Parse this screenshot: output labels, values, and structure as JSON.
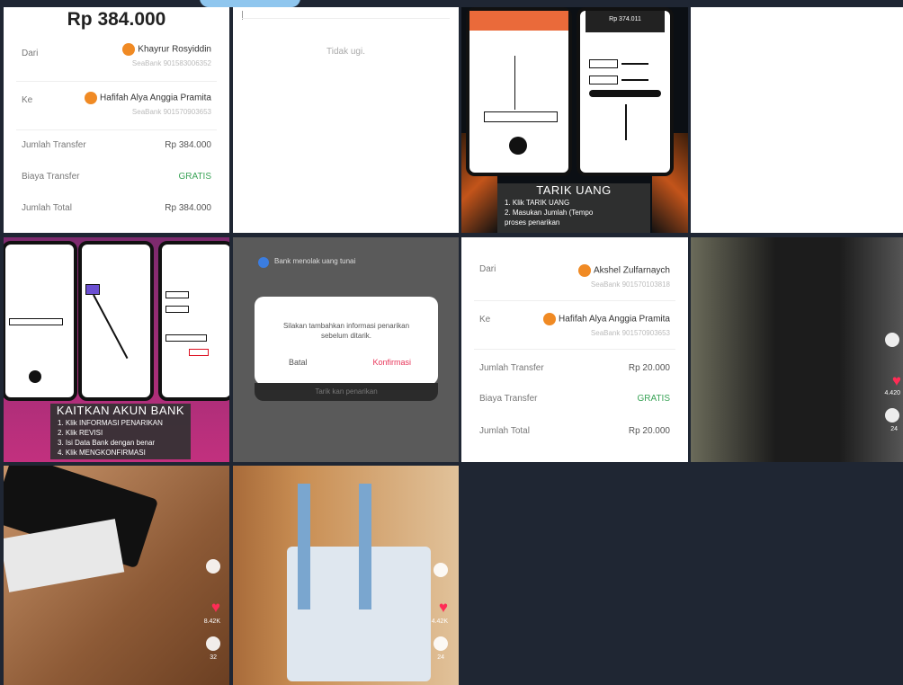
{
  "tile1": {
    "amount": "Rp 384.000",
    "from_label": "Dari",
    "from_name": "Khayrur Rosyiddin",
    "from_bank": "SeaBank 901583006352",
    "to_label": "Ke",
    "to_name": "Hafifah Alya Anggia Pramita",
    "to_bank": "SeaBank 901570903653",
    "transfer_label": "Jumlah Transfer",
    "transfer_value": "Rp 384.000",
    "fee_label": "Biaya Transfer",
    "fee_value": "GRATIS",
    "total_label": "Jumlah Total",
    "total_value": "Rp 384.000"
  },
  "tile2": {
    "text": "Tidak ugi."
  },
  "tile3": {
    "title": "TARIK UANG",
    "steps": [
      "1. Klik TARIK UANG",
      "2. Masukan Jumlah (Tempo",
      "proses penarikan"
    ],
    "phone_amount": "Rp 374.011"
  },
  "tile5": {
    "title": "KAITKAN AKUN BANK",
    "steps": [
      "1. Klik INFORMASI PENARIKAN",
      "2. Klik REVISI",
      "3. Isi Data Bank dengan benar",
      "4. Klik MENGKONFIRMASI"
    ]
  },
  "tile6": {
    "top_text": "Bank menolak uang tunai",
    "dialog_msg": "Silakan tambahkan informasi penarikan sebelum ditarik.",
    "cancel": "Batal",
    "confirm": "Konfirmasi",
    "bottom_text": "Tarik kan penarikan"
  },
  "tile7": {
    "from_label": "Dari",
    "from_name": "Akshel Zulfarnaych",
    "from_bank": "SeaBank 901570103818",
    "to_label": "Ke",
    "to_name": "Hafifah Alya Anggia Pramita",
    "to_bank": "SeaBank 901570903653",
    "transfer_label": "Jumlah Transfer",
    "transfer_value": "Rp 20.000",
    "fee_label": "Biaya Transfer",
    "fee_value": "GRATIS",
    "total_label": "Jumlah Total",
    "total_value": "Rp 20.000"
  },
  "tile8": {
    "likes": "4.420",
    "comments": "24"
  },
  "tile9": {
    "likes": "8.42K",
    "comments": "32"
  },
  "tile10": {
    "likes": "4.42K",
    "comments": "24"
  }
}
